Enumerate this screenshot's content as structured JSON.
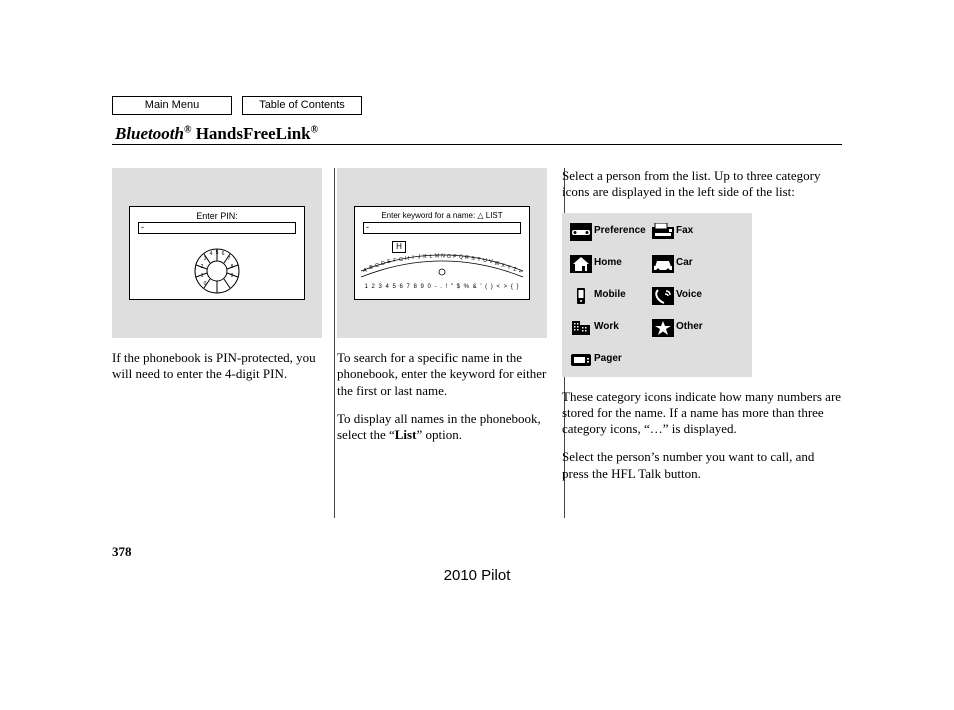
{
  "nav": {
    "main_menu": "Main Menu",
    "toc": "Table of Contents"
  },
  "title": {
    "prefix_italic": "Bluetooth",
    "reg1": "®",
    "suffix": " HandsFreeLink",
    "reg2": "®"
  },
  "col1": {
    "pin_label": "Enter PIN:",
    "pin_value": "-",
    "caption": "If the phonebook is PIN-protected, you will need to enter the 4-digit PIN."
  },
  "col2": {
    "search_label": "Enter keyword for a name: △ LIST",
    "search_value": "-",
    "highlight_key": "H",
    "alphabet": "A B C D E F G H I J K L M N O P Q R S T U V W X Y Z ↩",
    "numrow": "1 2 3 4 5 6 7 8 9 0 - . ! \" $ % & ' ( ) < > { }",
    "caption1": "To search for a specific name in the phonebook, enter the keyword for either the first or last name.",
    "caption2a": "To display all names in the phonebook, select the ",
    "caption2b": "List",
    "caption2c": " option."
  },
  "col3": {
    "intro": "Select a person from the list. Up to three category icons are displayed in the left side of the list:",
    "categories": [
      {
        "label": "Preference"
      },
      {
        "label": "Fax"
      },
      {
        "label": "Home"
      },
      {
        "label": "Car"
      },
      {
        "label": "Mobile"
      },
      {
        "label": "Voice"
      },
      {
        "label": "Work"
      },
      {
        "label": "Other"
      },
      {
        "label": "Pager"
      }
    ],
    "note1a": "These category icons indicate how many numbers are stored for the name. If a name has more than three category icons, ",
    "note1b": "…",
    "note1c": " is displayed.",
    "note2": "Select the person’s number you want to call, and press the HFL Talk button."
  },
  "page_number": "378",
  "model_year": "2010 Pilot"
}
